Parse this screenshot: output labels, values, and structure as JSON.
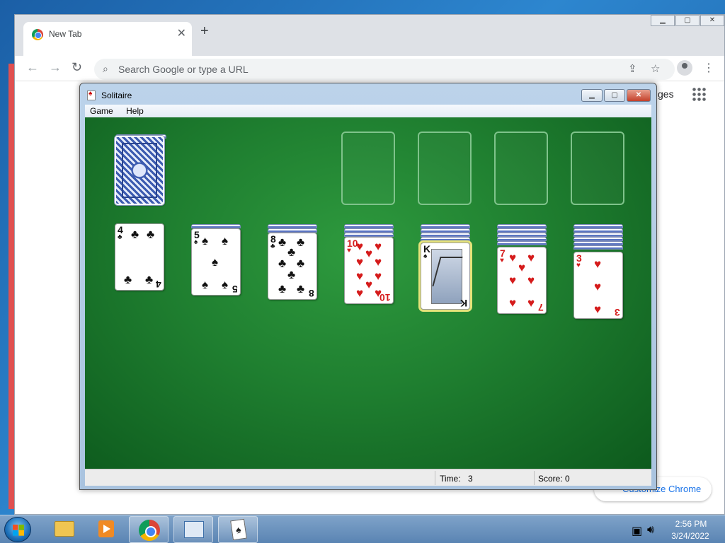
{
  "chrome": {
    "tab_title": "New Tab",
    "tab_close": "✕",
    "new_tab": "+",
    "back": "←",
    "forward": "→",
    "reload": "↻",
    "omnibox_placeholder": "Search Google or type a URL",
    "ntp_images_link": "ges",
    "customize_label": "Customize Chrome"
  },
  "solitaire": {
    "window_title": "Solitaire",
    "menu": [
      "Game",
      "Help"
    ],
    "status": {
      "time_label": "Time:",
      "time_value": "3",
      "score_label": "Score: 0"
    },
    "stock": {
      "state": "face-down"
    },
    "foundations": [
      "empty",
      "empty",
      "empty",
      "empty"
    ],
    "tableau": [
      {
        "hidden": 0,
        "rank": "4",
        "suit": "♣",
        "color": "black"
      },
      {
        "hidden": 1,
        "rank": "5",
        "suit": "♠",
        "color": "black"
      },
      {
        "hidden": 2,
        "rank": "8",
        "suit": "♣",
        "color": "black"
      },
      {
        "hidden": 3,
        "rank": "10",
        "suit": "♥",
        "color": "red"
      },
      {
        "hidden": 4,
        "rank": "K",
        "suit": "♠",
        "color": "black",
        "highlighted": true
      },
      {
        "hidden": 5,
        "rank": "7",
        "suit": "♥",
        "color": "red"
      },
      {
        "hidden": 6,
        "rank": "3",
        "suit": "♥",
        "color": "red"
      }
    ]
  },
  "taskbar": {
    "items": [
      "explorer-icon",
      "media-player-icon",
      "chrome-icon",
      "control-panel-icon",
      "solitaire-icon"
    ],
    "active_item": "solitaire-icon",
    "clock_time": "2:56 PM",
    "clock_date": "3/24/2022"
  },
  "colors": {
    "felt": "#1f7f30",
    "card_red": "#d51b1b",
    "taskbar": "#5a84b3"
  }
}
